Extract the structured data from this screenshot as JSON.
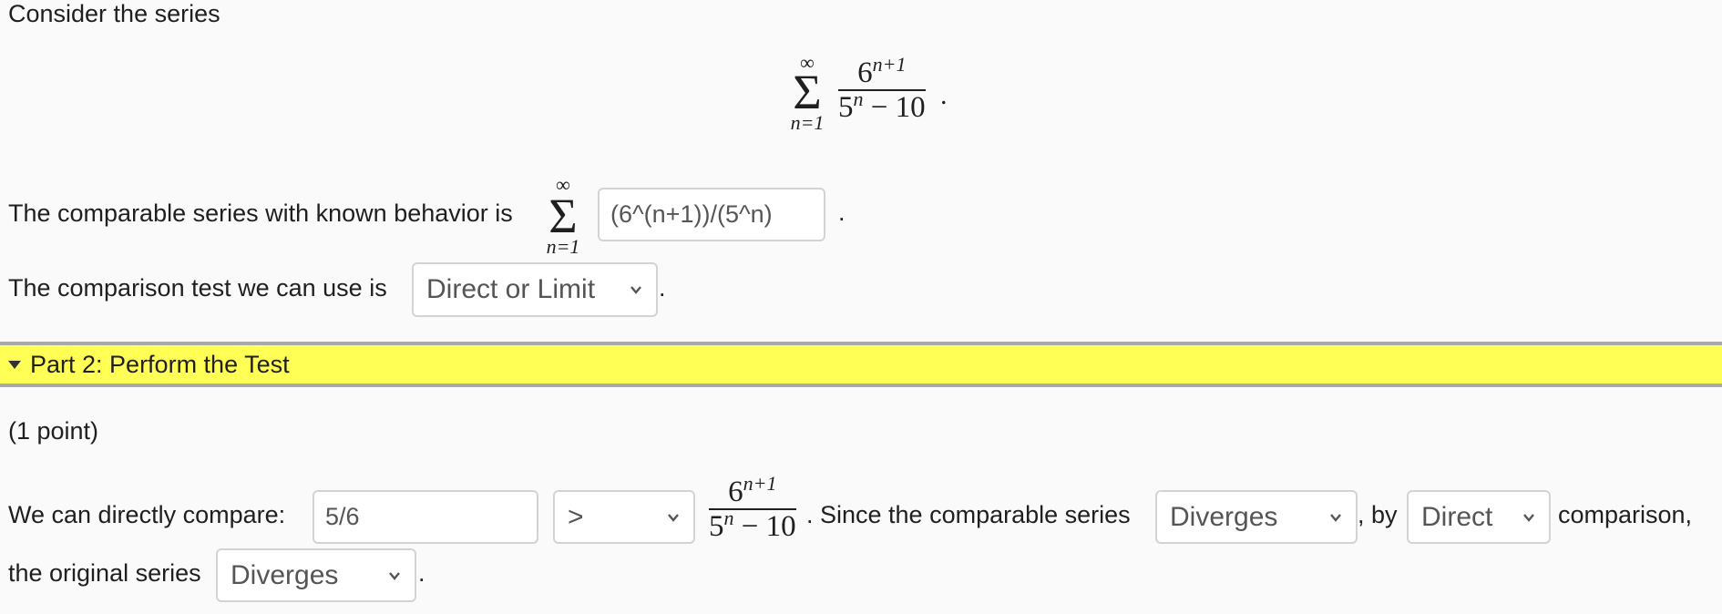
{
  "part1": {
    "intro": "Consider the series",
    "series": {
      "sum_upper": "∞",
      "sum_lower": "n=1",
      "numerator_base": "6",
      "numerator_exp": "n+1",
      "denominator_base": "5",
      "denominator_exp": "n",
      "denominator_rest": " − 10",
      "trailing": "."
    },
    "comparable_label": "The comparable series with known behavior is",
    "comparable_sum_upper": "∞",
    "comparable_sum_lower": "n=1",
    "comparable_input_value": "(6^(n+1))/(5^n)",
    "comparable_trailing": ".",
    "test_label": "The comparison test we can use is",
    "test_select_value": "Direct or Limit",
    "test_trailing": "."
  },
  "part2": {
    "header": "Part 2: Perform the Test",
    "points": "(1 point)",
    "compare_label": "We can directly compare:",
    "compare_input_value": "5/6",
    "relation_select_value": ">",
    "fraction": {
      "numerator_base": "6",
      "numerator_exp": "n+1",
      "denominator_base": "5",
      "denominator_exp": "n",
      "denominator_rest": " − 10"
    },
    "since_text": ". Since the comparable series",
    "comparable_behavior_select_value": "Diverges",
    "by_text": ", by",
    "method_select_value": "Direct",
    "comparison_text": "comparison,",
    "original_label": "the original series",
    "original_behavior_select_value": "Diverges",
    "final_trailing": "."
  }
}
